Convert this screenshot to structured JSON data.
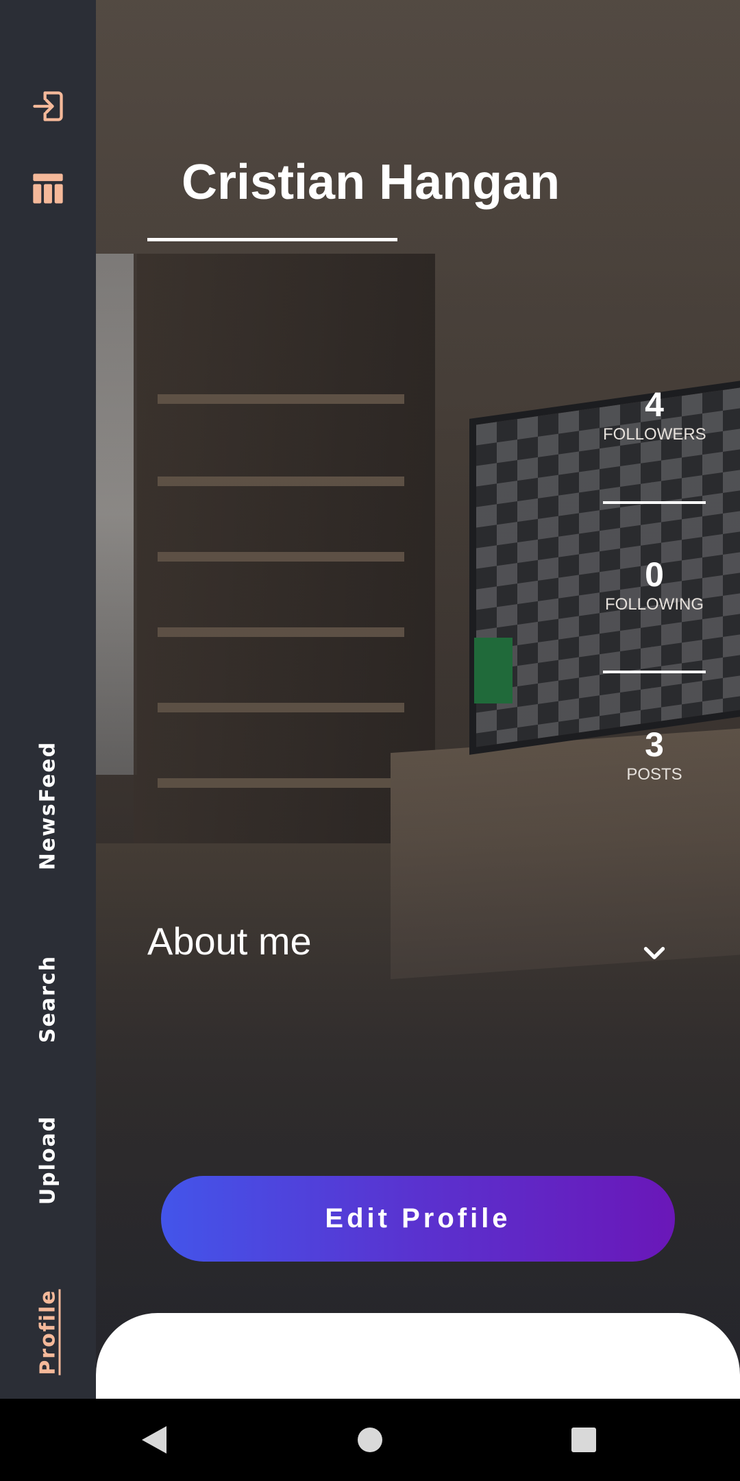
{
  "profile": {
    "name": "Cristian Hangan"
  },
  "stats": {
    "followers": {
      "value": "4",
      "label": "FOLLOWERS"
    },
    "following": {
      "value": "0",
      "label": "FOLLOWING"
    },
    "posts": {
      "value": "3",
      "label": "POSTS"
    }
  },
  "about": {
    "title": "About me"
  },
  "actions": {
    "edit_profile_label": "Edit Profile"
  },
  "sidebar": {
    "icons": [
      "logout-icon",
      "table-icon"
    ],
    "items": [
      {
        "label": "NewsFeed",
        "active": false
      },
      {
        "label": "Search",
        "active": false
      },
      {
        "label": "Upload",
        "active": false
      },
      {
        "label": "Profile",
        "active": true
      }
    ]
  },
  "system_nav": {
    "icons": [
      "back-icon",
      "home-icon",
      "recents-icon"
    ]
  },
  "colors": {
    "sidebar_bg": "#2b2e36",
    "accent": "#f5b99a",
    "button_gradient_start": "#4355ea",
    "button_gradient_end": "#6a17b8"
  }
}
